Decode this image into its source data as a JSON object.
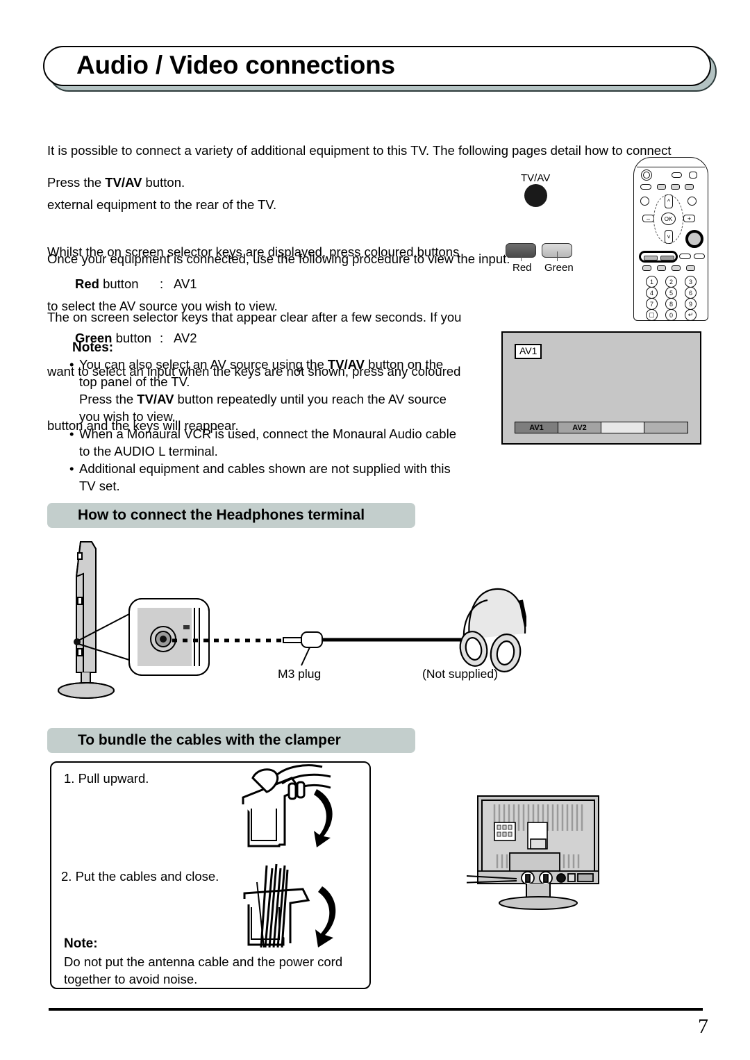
{
  "page": {
    "title": "Audio / Video connections",
    "number": "7"
  },
  "intro": {
    "line1": "It is possible to connect a variety of additional equipment to this TV. The following pages detail how to connect",
    "line2": "external equipment to the rear of the TV.",
    "line3": "Once your equipment is connected, use the following procedure to view the input:"
  },
  "steps": {
    "press_prefix": "Press the ",
    "press_bold": "TV/AV",
    "press_suffix": " button.",
    "whilst_line1": "Whilst the on screen selector keys are displayed, press coloured buttons",
    "whilst_line2": "to select the AV source you wish to view.",
    "button_map": [
      {
        "colour": "Red",
        "word": " button",
        "colon": ":",
        "source": "AV1"
      },
      {
        "colour": "Green",
        "word": " button",
        "colon": ":",
        "source": "AV2"
      }
    ],
    "onscreen_line1": "The on screen selector keys that appear clear after a few seconds. If you",
    "onscreen_line2": "want to select an input when the keys are not shown, press any coloured",
    "onscreen_line3": "button and the keys will reappear."
  },
  "notes": {
    "heading": "Notes:",
    "items": [
      {
        "bullet": "•",
        "part1": "You can also select an AV source using the ",
        "bold1": "TV/AV",
        "part2": " button on the",
        "line2": "top panel of the TV.",
        "sub_part1": "Press the ",
        "sub_bold": "TV/AV",
        "sub_part2": " button repeatedly until you reach the AV source",
        "sub_line2": "you wish to view."
      },
      {
        "bullet": "•",
        "part1": "When a Monaural VCR is used, connect the Monaural Audio cable",
        "line2": "to the AUDIO L terminal."
      },
      {
        "bullet": "•",
        "part1": "Additional equipment and cables shown are not supplied with this",
        "line2": "TV set."
      }
    ]
  },
  "remote_callout": {
    "tvav_label": "TV/AV",
    "red_label": "Red",
    "green_label": "Green",
    "numeric_keys": [
      "1",
      "2",
      "3",
      "4",
      "5",
      "6",
      "7",
      "8",
      "9",
      "▢",
      "0",
      "↵"
    ]
  },
  "osd": {
    "tag": "AV1",
    "segments": [
      "AV1",
      "AV2",
      "",
      ""
    ]
  },
  "sections": {
    "headphones": "How to connect the Headphones terminal",
    "clamper": "To bundle the cables with the clamper"
  },
  "headphone_diagram": {
    "plug_label": "M3 plug",
    "not_supplied_label": "(Not supplied)"
  },
  "clamper": {
    "step1": "1. Pull upward.",
    "step2": "2. Put the cables and close.",
    "note_heading": "Note:",
    "note_line1": "Do not put the antenna cable and the power cord",
    "note_line2": "together to avoid noise."
  },
  "colors": {
    "header_pill": "#c3cecc",
    "title_shadow": "#b3c2c2",
    "osd_background": "#c6c6c6",
    "red_button": "#4a4a4a",
    "green_button": "#b8b8b8"
  }
}
